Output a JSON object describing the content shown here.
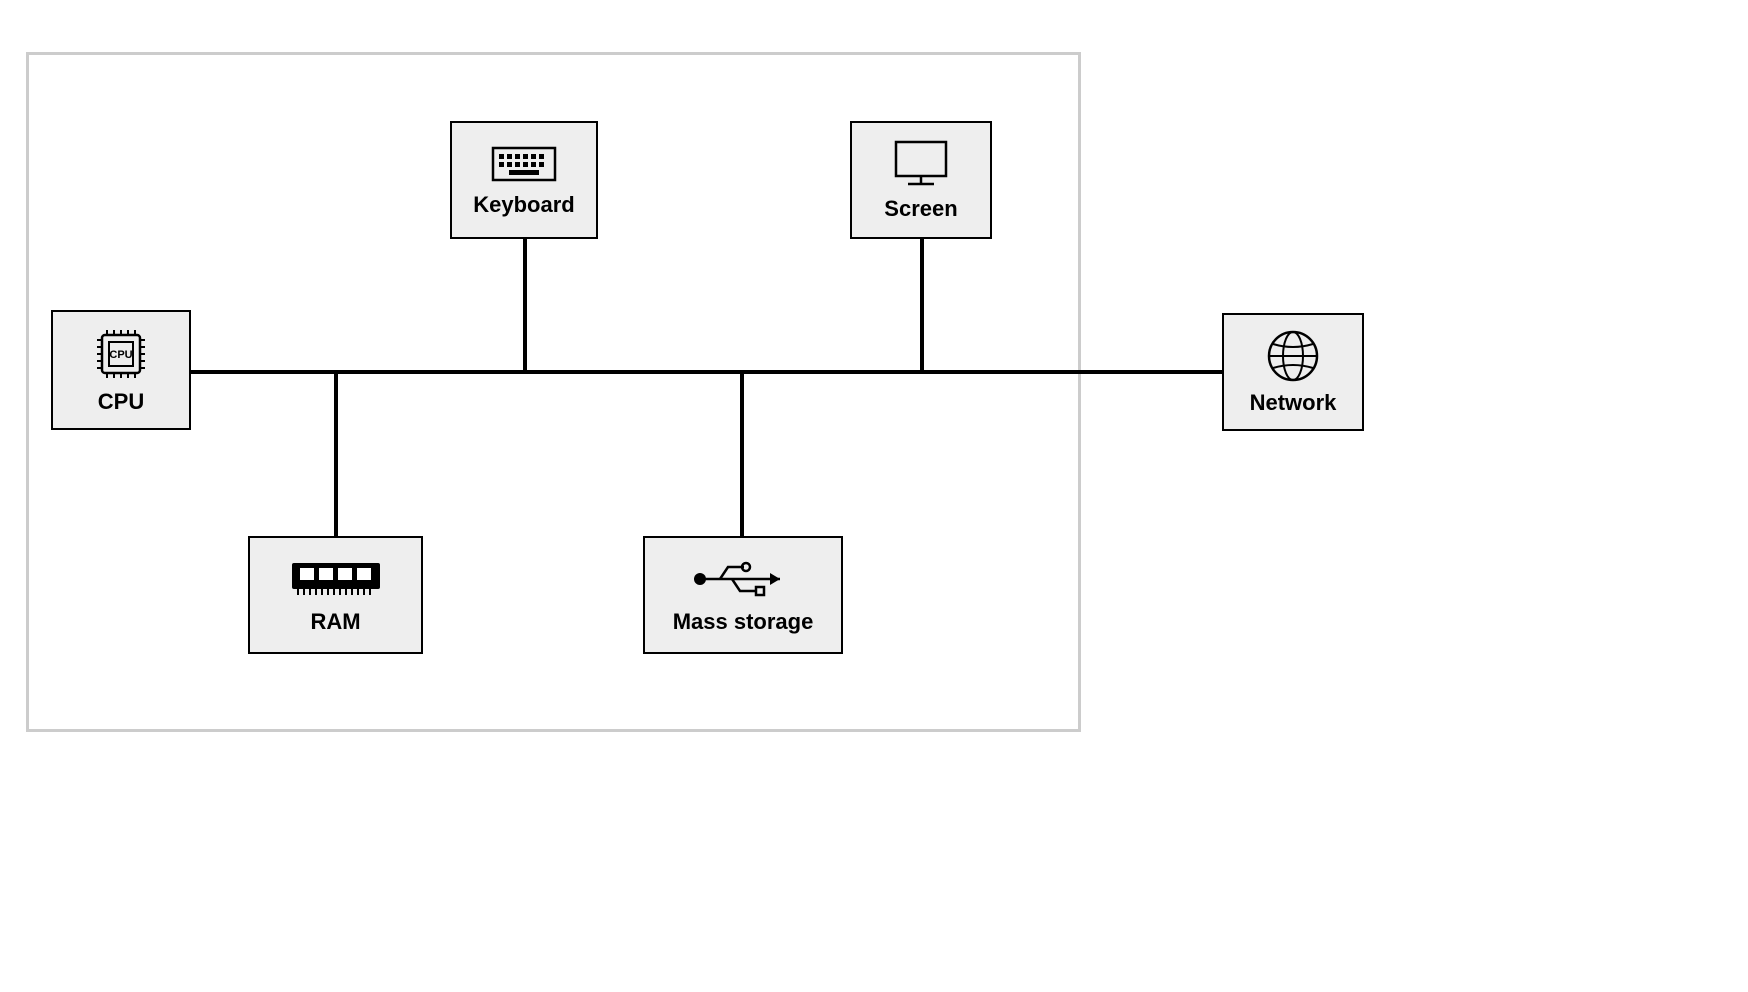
{
  "diagram": {
    "components": {
      "cpu": {
        "label": "CPU",
        "icon": "cpu-icon"
      },
      "keyboard": {
        "label": "Keyboard",
        "icon": "keyboard-icon"
      },
      "screen": {
        "label": "Screen",
        "icon": "screen-icon"
      },
      "network": {
        "label": "Network",
        "icon": "network-icon"
      },
      "ram": {
        "label": "RAM",
        "icon": "ram-icon"
      },
      "storage": {
        "label": "Mass storage",
        "icon": "usb-icon"
      }
    },
    "connections": [
      {
        "from": "cpu",
        "to": "bus"
      },
      {
        "from": "keyboard",
        "to": "bus"
      },
      {
        "from": "screen",
        "to": "bus"
      },
      {
        "from": "network",
        "to": "bus"
      },
      {
        "from": "ram",
        "to": "bus"
      },
      {
        "from": "storage",
        "to": "bus"
      }
    ],
    "cpu_chip_text": "CPU"
  }
}
